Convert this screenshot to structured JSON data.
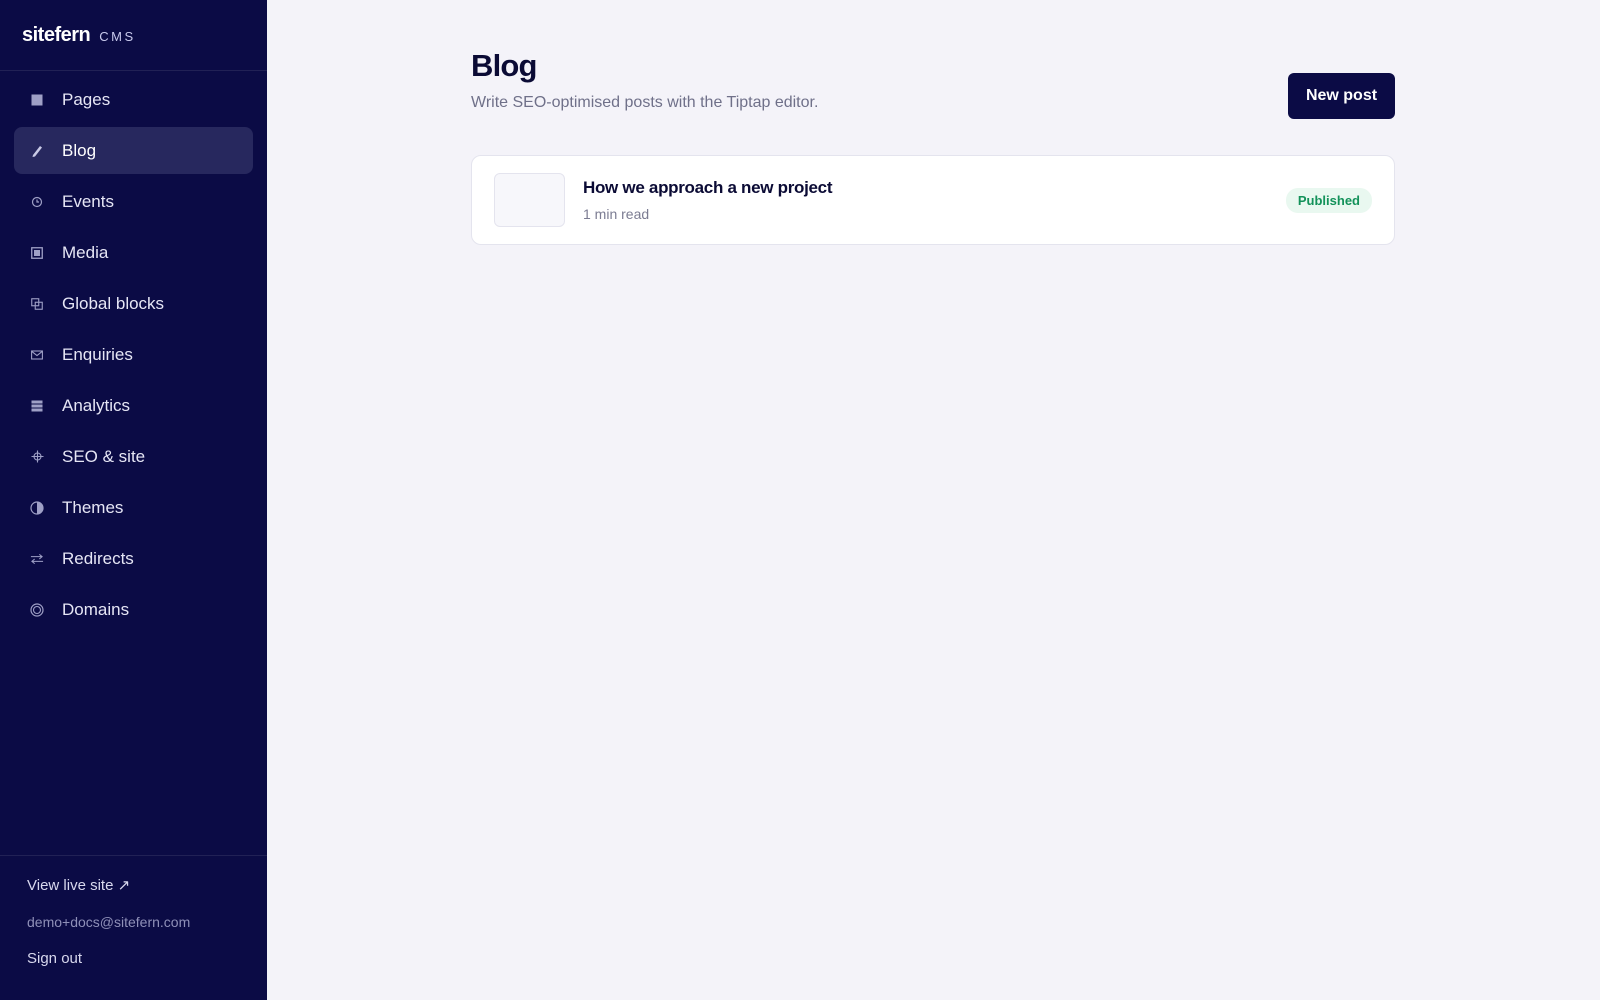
{
  "brand": {
    "name": "sitefern",
    "tag": "CMS"
  },
  "nav": {
    "items": [
      {
        "label": "Pages",
        "icon": "pages-icon",
        "active": false
      },
      {
        "label": "Blog",
        "icon": "pencil-icon",
        "active": true
      },
      {
        "label": "Events",
        "icon": "clock-icon",
        "active": false
      },
      {
        "label": "Media",
        "icon": "image-icon",
        "active": false
      },
      {
        "label": "Global blocks",
        "icon": "copy-icon",
        "active": false
      },
      {
        "label": "Enquiries",
        "icon": "envelope-icon",
        "active": false
      },
      {
        "label": "Analytics",
        "icon": "analytics-icon",
        "active": false
      },
      {
        "label": "SEO & site",
        "icon": "crosshair-icon",
        "active": false
      },
      {
        "label": "Themes",
        "icon": "half-circle-icon",
        "active": false
      },
      {
        "label": "Redirects",
        "icon": "arrows-icon",
        "active": false
      },
      {
        "label": "Domains",
        "icon": "globe-icon",
        "active": false
      }
    ]
  },
  "footer": {
    "live_site": "View live site ↗",
    "email": "demo+docs@sitefern.com",
    "sign_out": "Sign out"
  },
  "page": {
    "title": "Blog",
    "subtitle": "Write SEO-optimised posts with the Tiptap editor.",
    "new_post_label": "New post"
  },
  "posts": [
    {
      "title": "How we approach a new project",
      "meta": "1 min read",
      "status": "Published"
    }
  ],
  "colors": {
    "sidebar_bg": "#0b0b45",
    "active_item_bg": "#27285e",
    "primary_button": "#0b0b45",
    "published_badge_bg": "#e9f8f0",
    "published_badge_text": "#13925a",
    "main_bg": "#f4f3f9"
  }
}
